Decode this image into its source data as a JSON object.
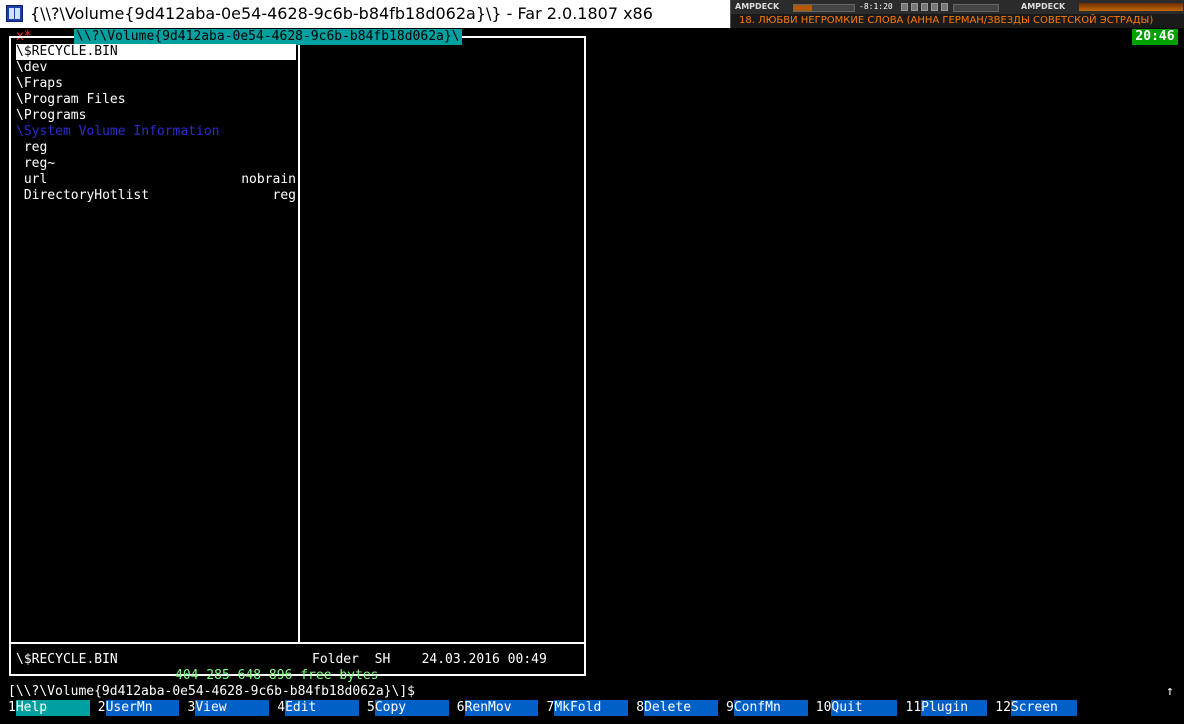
{
  "window": {
    "title": "{\\\\?\\Volume{9d412aba-0e54-4628-9c6b-b84fb18d062a}\\} - Far 2.0.1807 x86"
  },
  "player": {
    "logo_left": "AMPDECK",
    "logo_right": "AMPDECK",
    "time": "-8:1:20",
    "track": "18. ЛЮБВИ НЕГРОМКИЕ СЛОВА (АННА ГЕРМАН/ЗВЕЗДЫ СОВЕТСКОЙ ЭСТРАДЫ)",
    "accent_color": "#ff7a00",
    "position_fraction": 0.3
  },
  "console": {
    "clock": "20:46",
    "x_mark": "x*",
    "panel_header": "\\\\?\\Volume{9d412aba-0e54-4628-9c6b-b84fb18d062a}\\",
    "files": [
      {
        "name": "\\$RECYCLE.BIN",
        "size": "",
        "kind": "cursor"
      },
      {
        "name": "\\dev",
        "size": "",
        "kind": "dir"
      },
      {
        "name": "\\Fraps",
        "size": "",
        "kind": "dir"
      },
      {
        "name": "\\Program Files",
        "size": "",
        "kind": "dir"
      },
      {
        "name": "\\Programs",
        "size": "",
        "kind": "dir"
      },
      {
        "name": "\\System Volume Information",
        "size": "",
        "kind": "hidden"
      },
      {
        "name": " reg",
        "size": "",
        "kind": "file"
      },
      {
        "name": " reg~",
        "size": "",
        "kind": "file"
      },
      {
        "name": " url",
        "size": "nobrain",
        "kind": "file"
      },
      {
        "name": " DirectoryHotlist",
        "size": "reg",
        "kind": "file"
      }
    ],
    "status_name": "\\$RECYCLE.BIN",
    "status_info": "Folder  SH    24.03.2016 00:49",
    "free_bytes": "404 285 648 896 free bytes",
    "command_line": "[\\\\?\\Volume{9d412aba-0e54-4628-9c6b-b84fb18d062a}\\]$",
    "scroll_arrow": "↑"
  },
  "keybar": [
    {
      "num": "1",
      "label": "Help"
    },
    {
      "num": "2",
      "label": "UserMn"
    },
    {
      "num": "3",
      "label": "View"
    },
    {
      "num": "4",
      "label": "Edit"
    },
    {
      "num": "5",
      "label": "Copy"
    },
    {
      "num": "6",
      "label": "RenMov"
    },
    {
      "num": "7",
      "label": "MkFold"
    },
    {
      "num": "8",
      "label": "Delete"
    },
    {
      "num": "9",
      "label": "ConfMn"
    },
    {
      "num": "10",
      "label": "Quit"
    },
    {
      "num": "11",
      "label": "Plugin"
    },
    {
      "num": "12",
      "label": "Screen"
    }
  ],
  "colors": {
    "panel_bg": "#000000",
    "panel_fg": "#ffffff",
    "header_bg": "#00a0a0",
    "clock_bg": "#00a000",
    "keybar_label_bg": "#0060c8",
    "free_bytes_fg": "#80ff80",
    "hidden_fg": "#2b2bd0"
  }
}
